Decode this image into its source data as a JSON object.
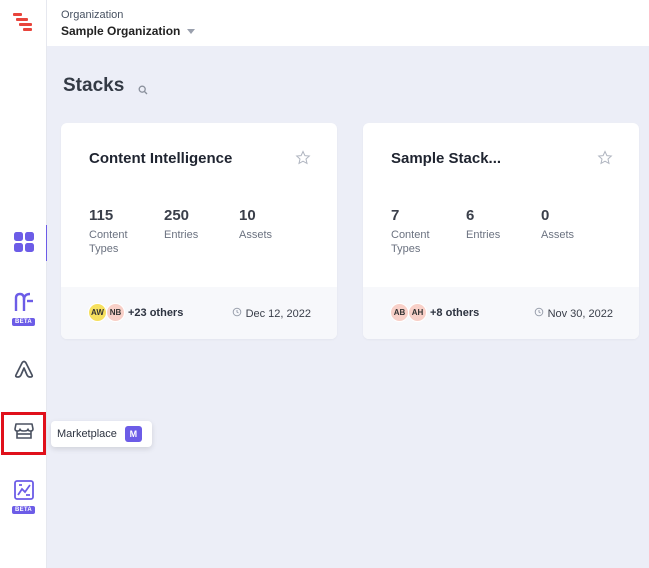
{
  "header": {
    "org_label": "Organization",
    "org_name": "Sample Organization"
  },
  "sidebar": {
    "items": [
      {
        "icon": "dashboard-grid-icon",
        "active": true
      },
      {
        "icon": "automations-icon",
        "badge": "BETA"
      },
      {
        "icon": "launch-icon"
      },
      {
        "icon": "marketplace-icon",
        "highlighted": true
      },
      {
        "icon": "analytics-icon",
        "badge": "BETA"
      }
    ]
  },
  "tooltip": {
    "label": "Marketplace",
    "shortcut": "M"
  },
  "main": {
    "title": "Stacks"
  },
  "stacks": [
    {
      "name": "Content Intelligence",
      "stats": [
        {
          "value": "115",
          "label": "Content Types"
        },
        {
          "value": "250",
          "label": "Entries"
        },
        {
          "value": "10",
          "label": "Assets"
        }
      ],
      "avatars": [
        {
          "initials": "AW",
          "color": "#f6e05e"
        },
        {
          "initials": "NB",
          "color": "#f8d0c8"
        }
      ],
      "others": "+23 others",
      "date": "Dec 12, 2022"
    },
    {
      "name": "Sample Stack...",
      "stats": [
        {
          "value": "7",
          "label": "Content Types"
        },
        {
          "value": "6",
          "label": "Entries"
        },
        {
          "value": "0",
          "label": "Assets"
        }
      ],
      "avatars": [
        {
          "initials": "AB",
          "color": "#f8d0c8"
        },
        {
          "initials": "AH",
          "color": "#f8d0c8"
        }
      ],
      "others": "+8 others",
      "date": "Nov 30, 2022"
    }
  ],
  "colors": {
    "accent": "#6c5ce7",
    "highlight": "#e0101b",
    "brand": "#e8453c",
    "background": "#eceef7"
  }
}
